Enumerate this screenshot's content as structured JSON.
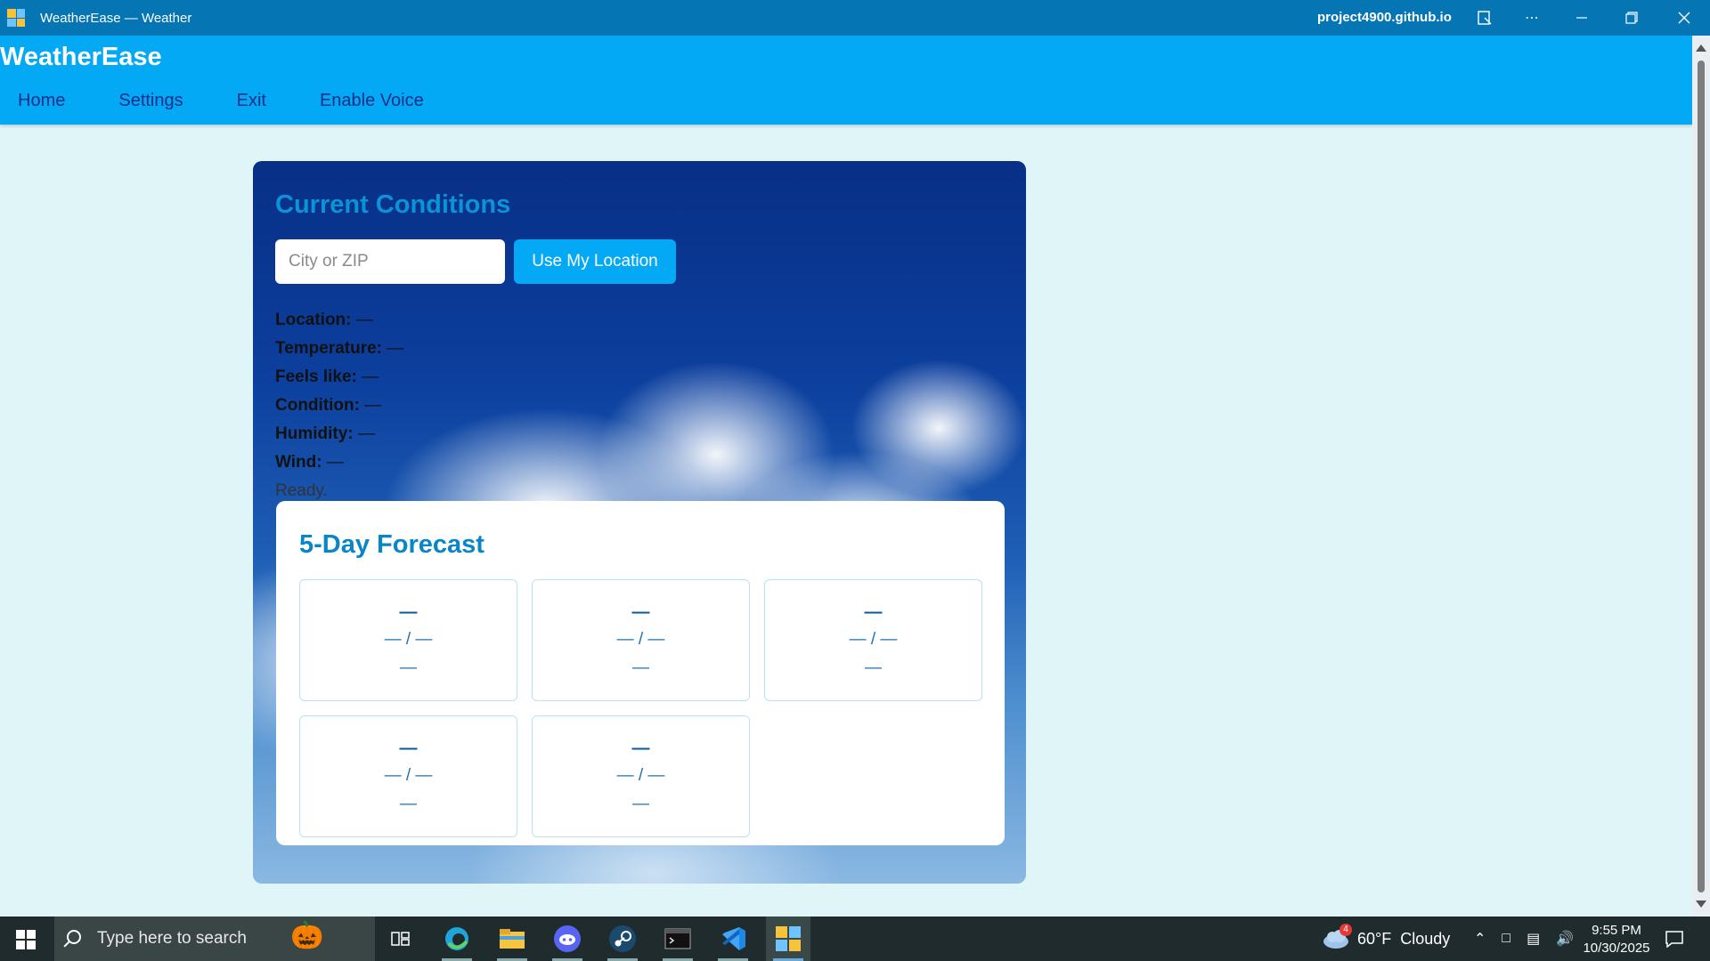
{
  "window": {
    "title": "WeatherEase — Weather",
    "url": "project4900.github.io"
  },
  "app": {
    "brand": "WeatherEase",
    "nav": [
      "Home",
      "Settings",
      "Exit",
      "Enable Voice"
    ]
  },
  "current": {
    "heading": "Current Conditions",
    "search_placeholder": "City or ZIP",
    "location_button": "Use My Location",
    "fields": [
      {
        "label": "Location:",
        "value": "—"
      },
      {
        "label": "Temperature:",
        "value": "—"
      },
      {
        "label": "Feels like:",
        "value": "—"
      },
      {
        "label": "Condition:",
        "value": "—"
      },
      {
        "label": "Humidity:",
        "value": "—"
      },
      {
        "label": "Wind:",
        "value": "—"
      }
    ],
    "status": "Ready."
  },
  "forecast": {
    "heading": "5-Day Forecast",
    "days": [
      {
        "day": "—",
        "temps": "— / —",
        "condition": "—"
      },
      {
        "day": "—",
        "temps": "— / —",
        "condition": "—"
      },
      {
        "day": "—",
        "temps": "— / —",
        "condition": "—"
      },
      {
        "day": "—",
        "temps": "— / —",
        "condition": "—"
      },
      {
        "day": "—",
        "temps": "— / —",
        "condition": "—"
      }
    ]
  },
  "taskbar": {
    "search_placeholder": "Type here to search",
    "weather": "60°F  Cloudy",
    "weather_badge": "4",
    "time": "9:55 PM",
    "date": "10/30/2025"
  },
  "colors": {
    "titlebar": "#0675b4",
    "header": "#03a9f4",
    "nav_link": "#0d2f8a",
    "heading": "#0a93d6",
    "page_bg": "#dff5f8"
  }
}
